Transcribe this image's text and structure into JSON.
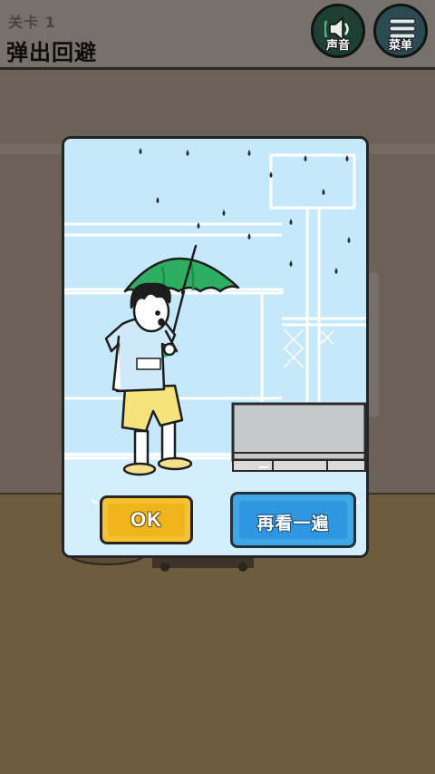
{
  "hud": {
    "level_label": "关卡 1",
    "level_name": "弹出回避",
    "sound_label": "声音",
    "menu_label": "菜单"
  },
  "popup": {
    "ok_label": "OK",
    "replay_label": "再看一遍"
  },
  "colors": {
    "popup_bg": "#c5e9fb",
    "umbrella": "#2fae63",
    "ok_button": "#f0b51d",
    "replay_button": "#2f97e0",
    "shorts": "#f5e27a"
  },
  "icons": {
    "sound": "speaker-icon",
    "menu": "hamburger-icon"
  }
}
